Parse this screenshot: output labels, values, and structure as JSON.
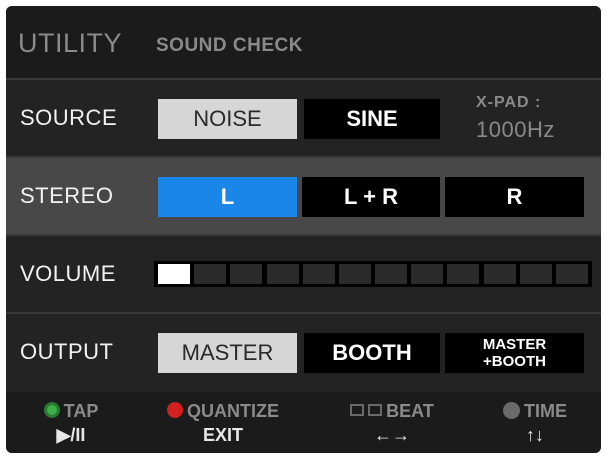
{
  "header": {
    "title": "UTILITY",
    "subtitle": "SOUND CHECK"
  },
  "source": {
    "label": "SOURCE",
    "options": [
      "NOISE",
      "SINE"
    ],
    "selected": "NOISE",
    "xpad_label": "X-PAD :",
    "xpad_value": "1000Hz"
  },
  "stereo": {
    "label": "STEREO",
    "options": [
      "L",
      "L + R",
      "R"
    ],
    "selected": "L"
  },
  "volume": {
    "label": "VOLUME",
    "segments_total": 12,
    "segments_lit": 1
  },
  "output": {
    "label": "OUTPUT",
    "options": [
      "MASTER",
      "BOOTH",
      "MASTER",
      "+BOOTH"
    ],
    "selected": "MASTER"
  },
  "footer": {
    "tap": {
      "label": "TAP",
      "action": "▶/II",
      "icon": "tap-button-icon"
    },
    "quantize": {
      "label": "QUANTIZE",
      "action": "EXIT",
      "icon": "record-icon"
    },
    "beat": {
      "label": "BEAT",
      "action": "←→",
      "icon": "beat-arrows-icon"
    },
    "time": {
      "label": "TIME",
      "action": "↑↓",
      "icon": "time-knob-icon"
    }
  },
  "colors": {
    "selected_blue": "#1a86e8",
    "selected_grey": "#d6d6d6",
    "tap_green": "#3db04a",
    "quantize_red": "#d21f1f"
  }
}
